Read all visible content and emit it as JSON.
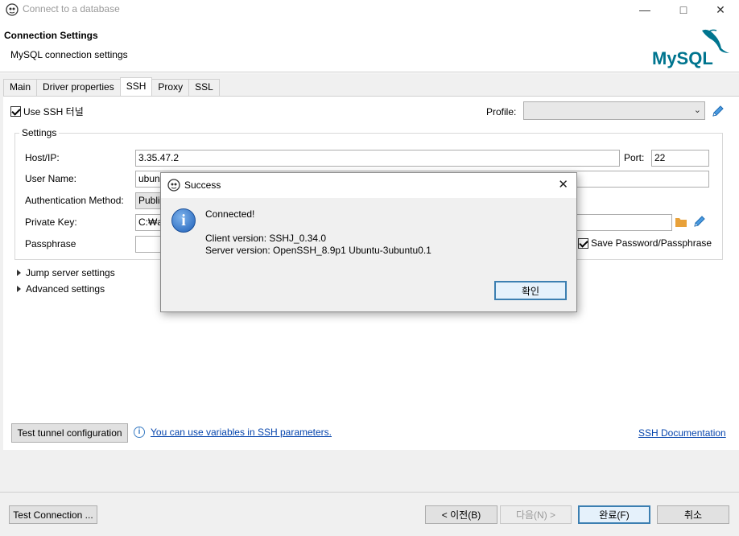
{
  "window": {
    "title": "Connect to a database"
  },
  "header": {
    "title": "Connection Settings",
    "subtitle": "MySQL connection settings",
    "logo_text": "MySQL"
  },
  "tabs": [
    {
      "label": "Main",
      "active": false
    },
    {
      "label": "Driver properties",
      "active": false
    },
    {
      "label": "SSH",
      "active": true
    },
    {
      "label": "Proxy",
      "active": false
    },
    {
      "label": "SSL",
      "active": false
    }
  ],
  "ssh": {
    "use_ssh_label": "Use SSH 터널",
    "use_ssh_checked": true,
    "profile_label": "Profile:",
    "profile_value": "",
    "settings_legend": "Settings",
    "host_label": "Host/IP:",
    "host_value": "3.35.47.2",
    "port_label": "Port:",
    "port_value": "22",
    "username_label": "User Name:",
    "username_value": "ubun",
    "auth_label": "Authentication Method:",
    "auth_value": "Publi",
    "private_key_label": "Private Key:",
    "private_key_value": "C:₩a",
    "passphrase_label": "Passphrase",
    "passphrase_value": "",
    "save_password_label": "Save Password/Passphrase",
    "save_password_checked": true,
    "jump_server_label": "Jump server settings",
    "advanced_label": "Advanced settings",
    "test_tunnel_button": "Test tunnel configuration",
    "variables_link": "You can use variables in SSH parameters.",
    "ssh_doc_link": "SSH Documentation"
  },
  "footer": {
    "test_connection": "Test Connection ...",
    "back": "< 이전(B)",
    "next": "다음(N) >",
    "finish": "완료(F)",
    "cancel": "취소"
  },
  "dialog": {
    "title": "Success",
    "message": "Connected!",
    "client_version": "Client version: SSHJ_0.34.0",
    "server_version": "Server version: OpenSSH_8.9p1 Ubuntu-3ubuntu0.1",
    "ok_button": "확인"
  },
  "colors": {
    "accent": "#3c7fb1",
    "link": "#0645ad",
    "folder": "#e8a13a",
    "mysql_blue": "#00758f",
    "mysql_orange": "#f29111"
  }
}
